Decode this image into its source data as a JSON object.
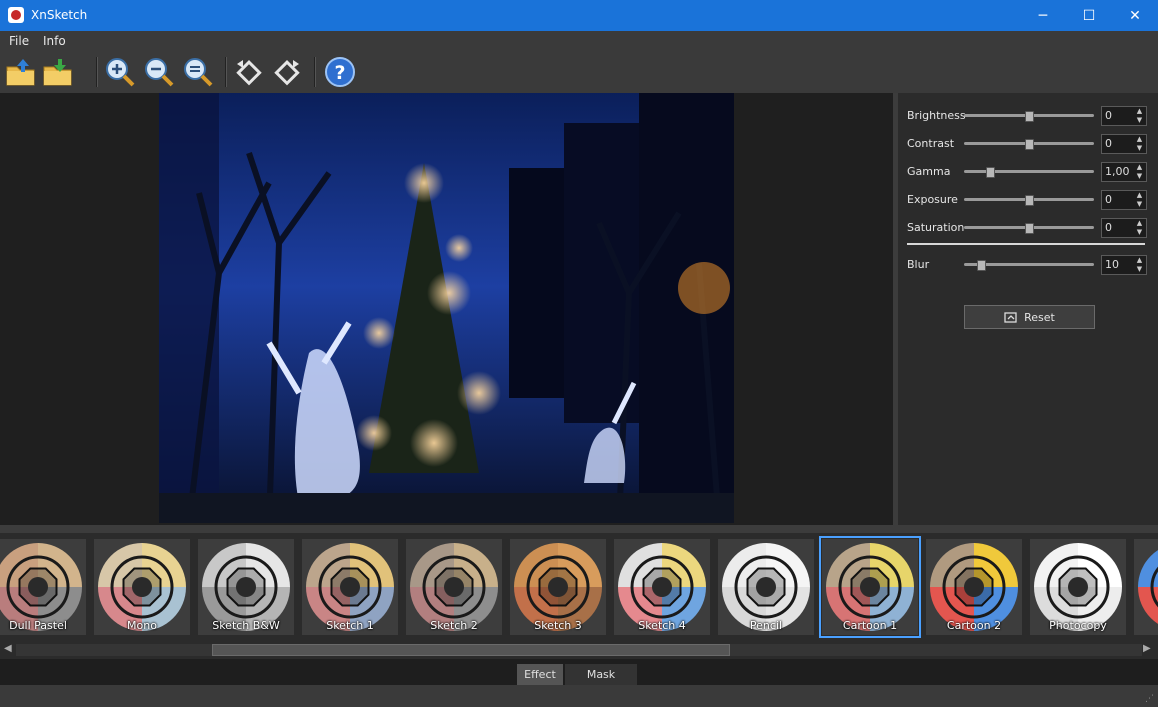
{
  "window": {
    "title": "XnSketch",
    "minimize": "─",
    "maximize": "☐",
    "close": "✕"
  },
  "menu": [
    "File",
    "Info"
  ],
  "toolbar": [
    {
      "name": "open-icon"
    },
    {
      "name": "save-icon"
    },
    {
      "name": "zoom-in-icon"
    },
    {
      "name": "zoom-out-icon"
    },
    {
      "name": "zoom-fit-icon"
    },
    {
      "name": "rotate-left-icon"
    },
    {
      "name": "rotate-right-icon"
    },
    {
      "name": "help-icon"
    }
  ],
  "adjustments": {
    "sliders": [
      {
        "label": "Brightness",
        "value": "0",
        "fraction": 0.5
      },
      {
        "label": "Contrast",
        "value": "0",
        "fraction": 0.5
      },
      {
        "label": "Gamma",
        "value": "1,00",
        "fraction": 0.2
      },
      {
        "label": "Exposure",
        "value": "0",
        "fraction": 0.5
      },
      {
        "label": "Saturation",
        "value": "0",
        "fraction": 0.5
      }
    ],
    "blur": {
      "label": "Blur",
      "value": "10",
      "fraction": 0.13
    },
    "reset_label": "Reset"
  },
  "effects": [
    {
      "label": "Dull Pastel",
      "colors": [
        "#c9a07f",
        "#d2b48c",
        "#b97d7d",
        "#8d8d8d"
      ]
    },
    {
      "label": "Mono",
      "colors": [
        "#d7c7a8",
        "#e8d392",
        "#d7888c",
        "#a9c2d2"
      ]
    },
    {
      "label": "Sketch B&W",
      "colors": [
        "#c8c8c8",
        "#e6e6e6",
        "#9a9a9a",
        "#b5b5b5"
      ]
    },
    {
      "label": "Sketch 1",
      "colors": [
        "#bca58c",
        "#e1c27a",
        "#c98585",
        "#8fa3c2"
      ]
    },
    {
      "label": "Sketch 2",
      "colors": [
        "#a89888",
        "#c8b08a",
        "#b27f7f",
        "#8e8e8e"
      ]
    },
    {
      "label": "Sketch 3",
      "colors": [
        "#cc8f53",
        "#d89c5c",
        "#c2704a",
        "#a87048"
      ]
    },
    {
      "label": "Sketch 4",
      "colors": [
        "#e0e0e0",
        "#ecd77e",
        "#e5898e",
        "#6fa5e0"
      ]
    },
    {
      "label": "Pencil",
      "colors": [
        "#ececec",
        "#f5f5f5",
        "#d8d8d8",
        "#e3e3e3"
      ]
    },
    {
      "label": "Cartoon 1",
      "colors": [
        "#b8a48a",
        "#e7d56a",
        "#d77474",
        "#8fb2d4"
      ]
    },
    {
      "label": "Cartoon 2",
      "colors": [
        "#b09a80",
        "#f0c93b",
        "#e3564f",
        "#4f8fe0"
      ]
    },
    {
      "label": "Photocopy",
      "colors": [
        "#f2f2f2",
        "#ffffff",
        "#dcdcdc",
        "#ededed"
      ]
    },
    {
      "label": "",
      "colors": [
        "#4f8fe0",
        "#f0c93b",
        "#e3564f",
        "#4f8fe0"
      ]
    }
  ],
  "tabs": [
    {
      "label": "Effect",
      "active": true
    },
    {
      "label": "Mask",
      "active": false
    }
  ],
  "accent": "#1a73d9"
}
